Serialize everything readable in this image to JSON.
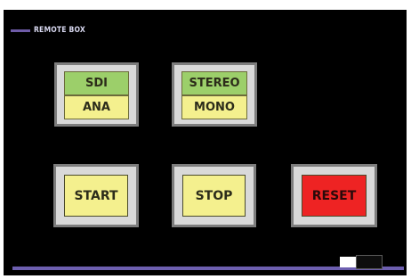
{
  "panel": {
    "title": "REMOTE BOX"
  },
  "input_toggle": {
    "option_a": "SDI",
    "option_b": "ANA",
    "selected": "SDI"
  },
  "audio_toggle": {
    "option_a": "STEREO",
    "option_b": "MONO",
    "selected": "STEREO"
  },
  "controls": {
    "start_label": "START",
    "stop_label": "STOP",
    "reset_label": "RESET"
  },
  "colors": {
    "background": "#000000",
    "selected": "#9ccf6a",
    "unselected": "#f4f08e",
    "reset": "#ee2323",
    "accent": "#6d5fb0"
  },
  "icons": {
    "title_marker": "line-marker-icon",
    "scroll": "scroll-thumb-icon"
  }
}
